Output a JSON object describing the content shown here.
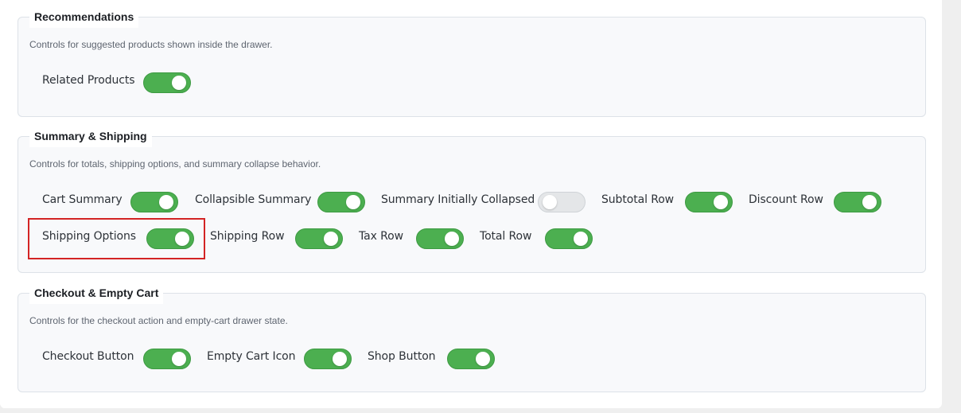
{
  "colors": {
    "toggle_on": "#4caf50",
    "toggle_off": "#e4e6e8",
    "highlight": "#d32424"
  },
  "recommendations": {
    "title": "Recommendations",
    "description": "Controls for suggested products shown inside the drawer.",
    "toggles": [
      {
        "label": "Related Products",
        "enabled": true
      }
    ]
  },
  "summary_shipping": {
    "title": "Summary & Shipping",
    "description": "Controls for totals, shipping options, and summary collapse behavior.",
    "toggles": [
      {
        "label": "Cart Summary",
        "enabled": true
      },
      {
        "label": "Collapsible Summary",
        "enabled": true
      },
      {
        "label": "Summary Initially Collapsed",
        "enabled": false
      },
      {
        "label": "Subtotal Row",
        "enabled": true
      },
      {
        "label": "Discount Row",
        "enabled": true
      },
      {
        "label": "Shipping Options",
        "enabled": true
      },
      {
        "label": "Shipping Row",
        "enabled": true
      },
      {
        "label": "Tax Row",
        "enabled": true
      },
      {
        "label": "Total Row",
        "enabled": true
      }
    ]
  },
  "checkout_empty": {
    "title": "Checkout & Empty Cart",
    "description": "Controls for the checkout action and empty-cart drawer state.",
    "toggles": [
      {
        "label": "Checkout Button",
        "enabled": true
      },
      {
        "label": "Empty Cart Icon",
        "enabled": true
      },
      {
        "label": "Shop Button",
        "enabled": true
      }
    ]
  }
}
